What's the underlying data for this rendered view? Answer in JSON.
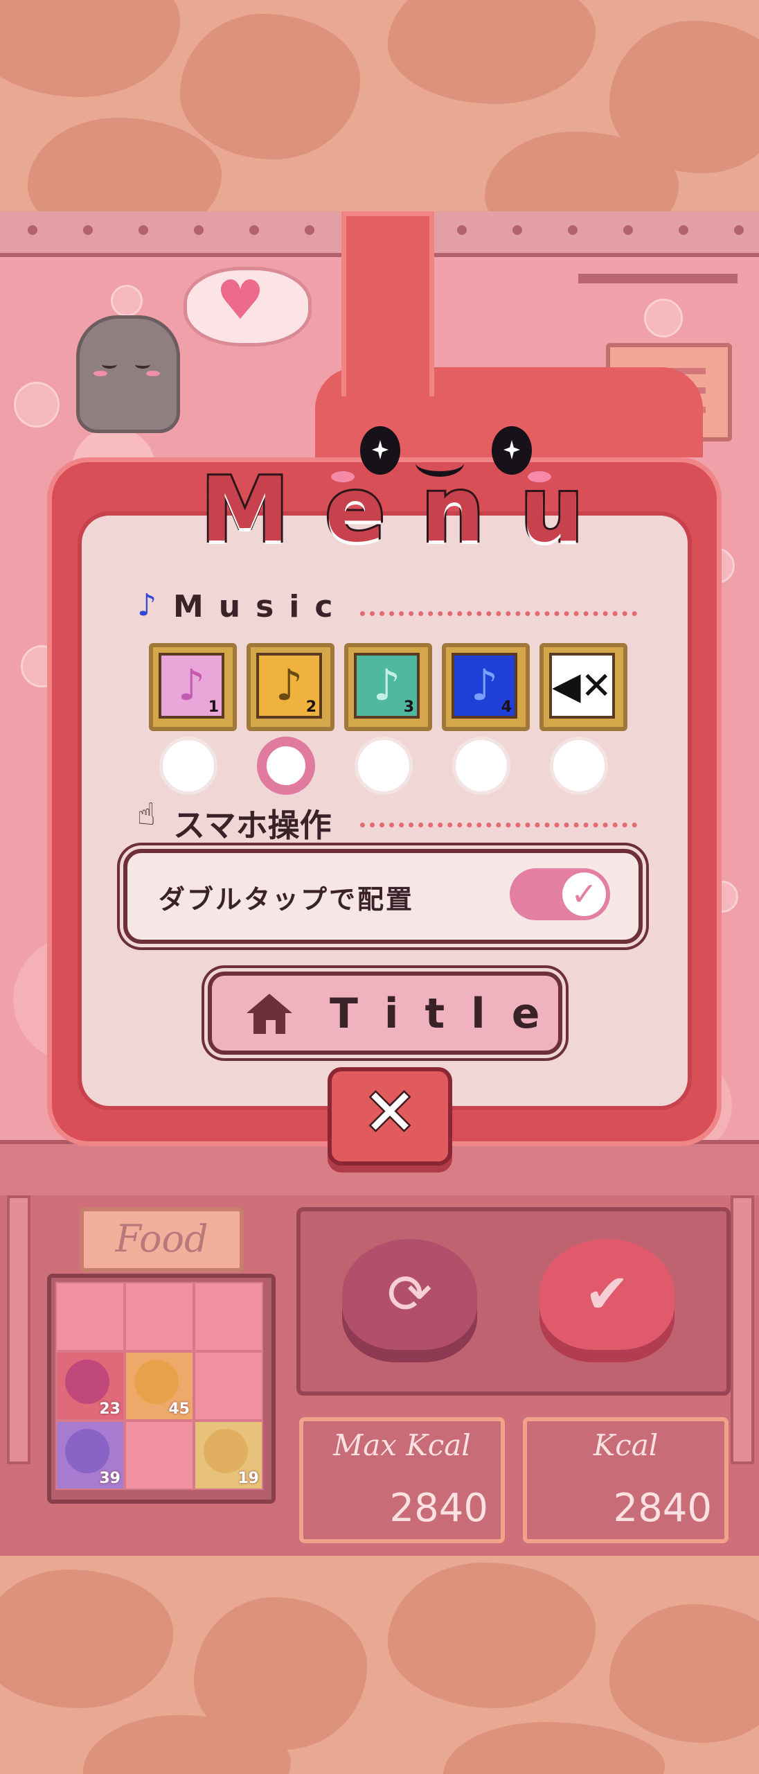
{
  "menu": {
    "title": "Menu",
    "music": {
      "label": "Music",
      "tracks": [
        {
          "number": "1",
          "color": "#e8a6d9",
          "glyph_color": "#c35cb0",
          "name": "music-track-1"
        },
        {
          "number": "2",
          "color": "#f0b23f",
          "glyph_color": "#6a4a10",
          "name": "music-track-2"
        },
        {
          "number": "3",
          "color": "#4fb89f",
          "glyph_color": "#c4f0e3",
          "name": "music-track-3"
        },
        {
          "number": "4",
          "color": "#1f3fd6",
          "glyph_color": "#7aa0ff",
          "name": "music-track-4"
        },
        {
          "number": "",
          "color": "#ffffff",
          "glyph_color": "#111111",
          "name": "music-mute"
        }
      ],
      "selected_index": 1
    },
    "touch": {
      "label": "スマホ操作",
      "double_tap_label": "ダブルタップで配置",
      "double_tap_enabled": true
    },
    "title_button": "Title",
    "close_glyph": "✕"
  },
  "game": {
    "food_label": "Food",
    "food_items": [
      {
        "count": "23",
        "color": "#c0487a"
      },
      {
        "count": "45",
        "color": "#e6a24a"
      },
      {
        "count": "39",
        "color": "#8a63c6"
      },
      {
        "count": "19",
        "color": "#e0b060"
      }
    ],
    "max_kcal_label": "Max Kcal",
    "max_kcal_value": "2840",
    "kcal_label": "Kcal",
    "kcal_value": "2840"
  },
  "colors": {
    "accent": "#c7424c",
    "toggle_on": "#e27fa3"
  }
}
